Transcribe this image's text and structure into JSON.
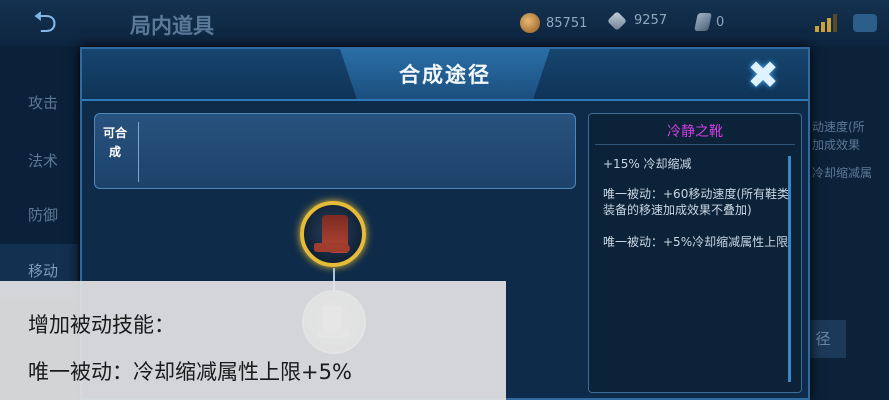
{
  "header": {
    "back_icon": "back-arrow-icon",
    "title": "局内道具",
    "gold": "85751",
    "diamond": "9257",
    "coupon": "0"
  },
  "side_nav": [
    {
      "label": "攻击",
      "active": false
    },
    {
      "label": "法术",
      "active": false
    },
    {
      "label": "防御",
      "active": false
    },
    {
      "label": "移动",
      "active": true
    }
  ],
  "background_right": {
    "text1": "动速度(所",
    "text2": "加成效果",
    "text3": "冷却缩减属",
    "button": "径"
  },
  "modal": {
    "title": "合成途径",
    "close_icon": "close-x-icon",
    "craft_label": "可合成",
    "main_item_icon": "boot-icon",
    "sub_item_icon": "shoe-icon"
  },
  "item_info": {
    "name": "冷静之靴",
    "stat": "+15% 冷却缩减",
    "passive1": "唯一被动：+60移动速度(所有鞋类装备的移速加成效果不叠加)",
    "passive2": "唯一被动：+5%冷却缩减属性上限"
  },
  "overlay": {
    "line1": "增加被动技能：",
    "line2": "唯一被动：冷却缩减属性上限+5%"
  },
  "colors": {
    "accent": "#2e79b8",
    "item_name": "#d23fe0",
    "gold_ring": "#e6bb38"
  }
}
